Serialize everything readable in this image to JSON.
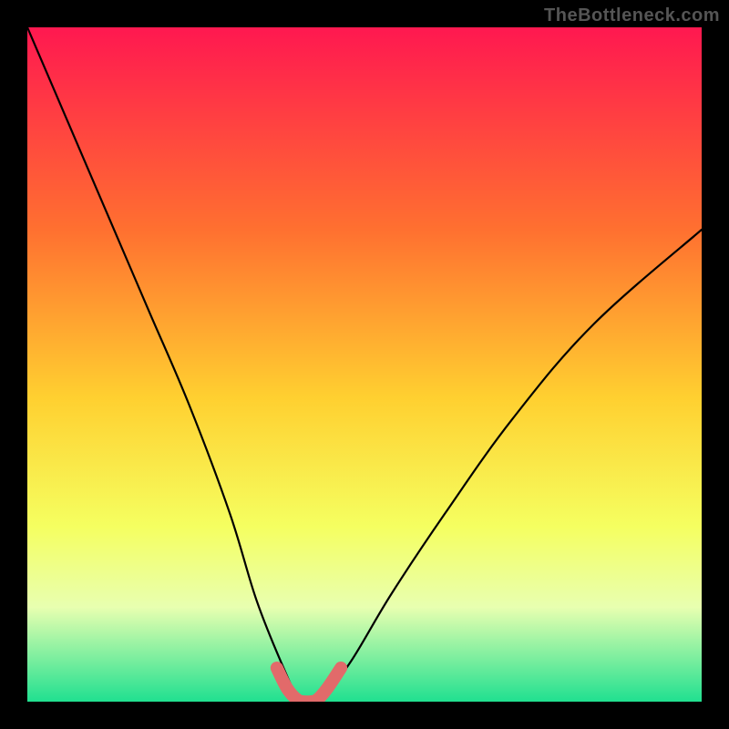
{
  "watermark": "TheBottleneck.com",
  "colors": {
    "gradient_top": "#ff1850",
    "gradient_upper_mid": "#ff7030",
    "gradient_mid": "#ffd030",
    "gradient_lower_mid": "#f5ff60",
    "gradient_low": "#e8ffb0",
    "gradient_bottom": "#20e090",
    "curve": "#000000",
    "highlight": "#e26a6a"
  },
  "chart_data": {
    "type": "line",
    "title": "",
    "xlabel": "",
    "ylabel": "",
    "xlim": [
      0,
      100
    ],
    "ylim": [
      0,
      100
    ],
    "series": [
      {
        "name": "bottleneck-curve",
        "x": [
          0,
          6,
          12,
          18,
          24,
          30,
          34,
          38,
          40,
          42,
          44,
          48,
          54,
          62,
          72,
          84,
          100
        ],
        "y": [
          100,
          86,
          72,
          58,
          44,
          28,
          15,
          5,
          1,
          0,
          1,
          6,
          16,
          28,
          42,
          56,
          70
        ]
      },
      {
        "name": "optimal-zone",
        "x": [
          37,
          38.5,
          40,
          41,
          42,
          43,
          44.5,
          46.5
        ],
        "y": [
          5,
          2,
          0.3,
          0,
          0,
          0.3,
          2,
          5
        ]
      }
    ]
  }
}
